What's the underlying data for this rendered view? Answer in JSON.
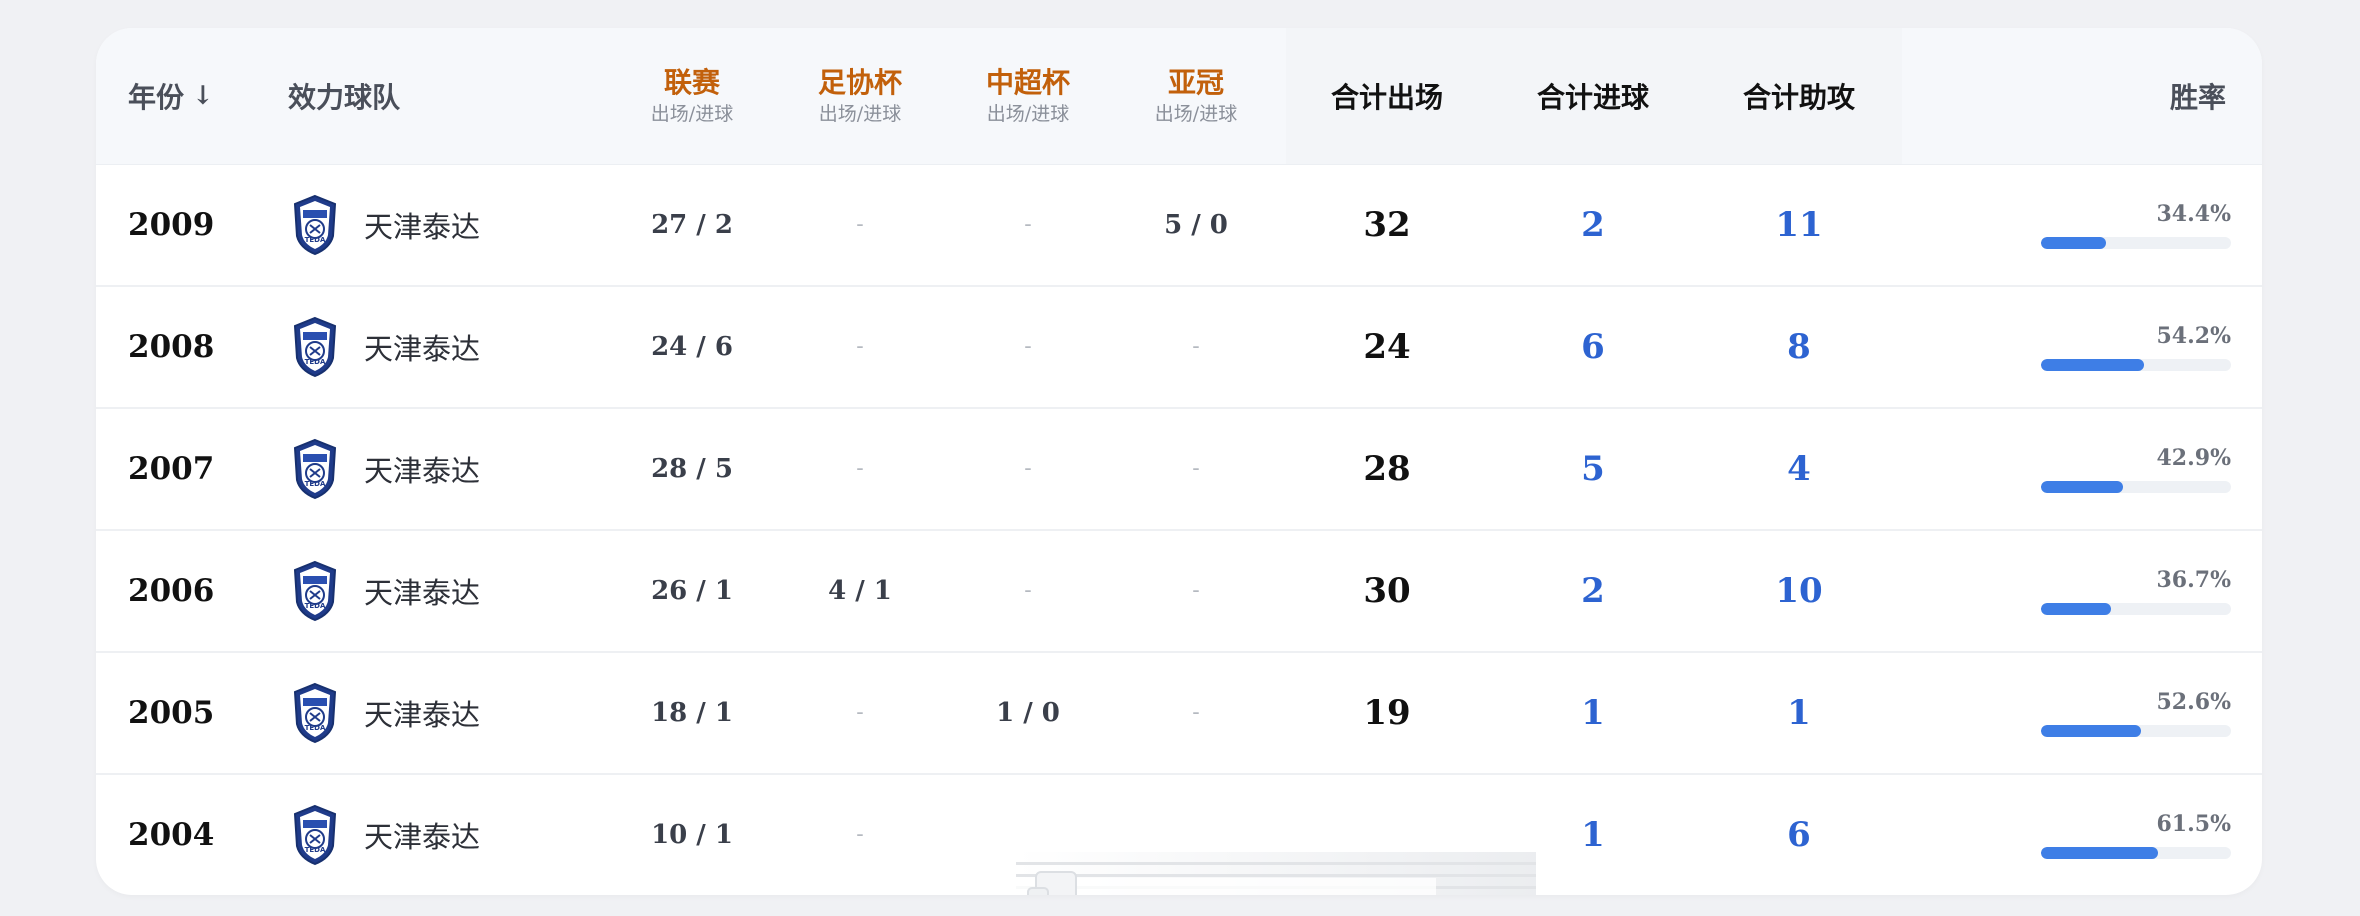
{
  "header": {
    "year_label": "年份",
    "sort_arrow": "↓",
    "team_label": "效力球队",
    "competitions": [
      {
        "name": "联赛",
        "sub": "出场/进球"
      },
      {
        "name": "足协杯",
        "sub": "出场/进球"
      },
      {
        "name": "中超杯",
        "sub": "出场/进球"
      },
      {
        "name": "亚冠",
        "sub": "出场/进球"
      }
    ],
    "total_apps_label": "合计出场",
    "total_goals_label": "合计进球",
    "total_assists_label": "合计助攻",
    "win_rate_label": "胜率"
  },
  "colors": {
    "competition_header": "#c2600b",
    "accent_blue": "#2d63d1",
    "bar_fill": "#3e7ee6"
  },
  "team_icon": "teda-crest-icon",
  "rows": [
    {
      "year": "2009",
      "team": "天津泰达",
      "league": "27 / 2",
      "fa_cup": "-",
      "super_cup": "-",
      "acl": "5 / 0",
      "apps": "32",
      "goals": "2",
      "assists": "11",
      "win_rate": "34.4%",
      "win_rate_value": 0.344
    },
    {
      "year": "2008",
      "team": "天津泰达",
      "league": "24 / 6",
      "fa_cup": "-",
      "super_cup": "-",
      "acl": "-",
      "apps": "24",
      "goals": "6",
      "assists": "8",
      "win_rate": "54.2%",
      "win_rate_value": 0.542
    },
    {
      "year": "2007",
      "team": "天津泰达",
      "league": "28 / 5",
      "fa_cup": "-",
      "super_cup": "-",
      "acl": "-",
      "apps": "28",
      "goals": "5",
      "assists": "4",
      "win_rate": "42.9%",
      "win_rate_value": 0.429
    },
    {
      "year": "2006",
      "team": "天津泰达",
      "league": "26 / 1",
      "fa_cup": "4 / 1",
      "super_cup": "-",
      "acl": "-",
      "apps": "30",
      "goals": "2",
      "assists": "10",
      "win_rate": "36.7%",
      "win_rate_value": 0.367
    },
    {
      "year": "2005",
      "team": "天津泰达",
      "league": "18 / 1",
      "fa_cup": "-",
      "super_cup": "1 / 0",
      "acl": "-",
      "apps": "19",
      "goals": "1",
      "assists": "1",
      "win_rate": "52.6%",
      "win_rate_value": 0.526
    },
    {
      "year": "2004",
      "team": "天津泰达",
      "league": "10 / 1",
      "fa_cup": "-",
      "super_cup": "",
      "acl": "",
      "apps": "",
      "goals": "1",
      "assists": "6",
      "win_rate": "61.5%",
      "win_rate_value": 0.615
    }
  ]
}
